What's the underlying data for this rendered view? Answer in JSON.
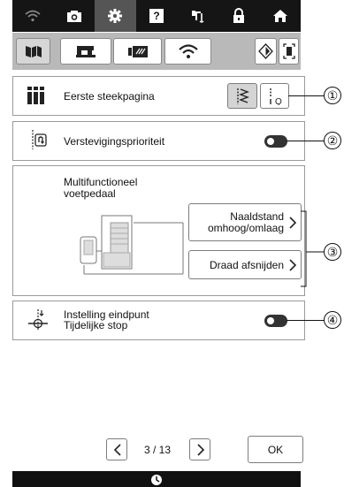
{
  "top_tabs": [
    {
      "icon": "wifi-icon",
      "active": false
    },
    {
      "icon": "camera-icon",
      "active": false
    },
    {
      "icon": "gear-icon",
      "active": true
    },
    {
      "icon": "help-icon",
      "active": false
    },
    {
      "icon": "needle-icon",
      "active": false
    },
    {
      "icon": "lock-icon",
      "active": false
    },
    {
      "icon": "home-icon",
      "active": false
    }
  ],
  "help_glyph": "?",
  "settings_tabs": [
    "machine-settings-icon",
    "sewing-settings-icon",
    "embroidery-settings-icon",
    "wifi-settings-icon"
  ],
  "rows": {
    "first_page": {
      "label": "Eerste steekpagina",
      "callout": "①"
    },
    "reinforce": {
      "label": "Verstevigingsprioriteit",
      "callout": "②"
    },
    "pedal": {
      "title_line1": "Multifunctioneel",
      "title_line2": "voetpedaal",
      "needle_btn_line1": "Naaldstand",
      "needle_btn_line2": "omhoog/omlaag",
      "cut_btn": "Draad afsnijden",
      "callout": "③"
    },
    "endpoint": {
      "label_line1": "Instelling eindpunt",
      "label_line2": "Tijdelijke stop",
      "callout": "④"
    }
  },
  "pager": {
    "text": "3 / 13",
    "ok": "OK"
  }
}
